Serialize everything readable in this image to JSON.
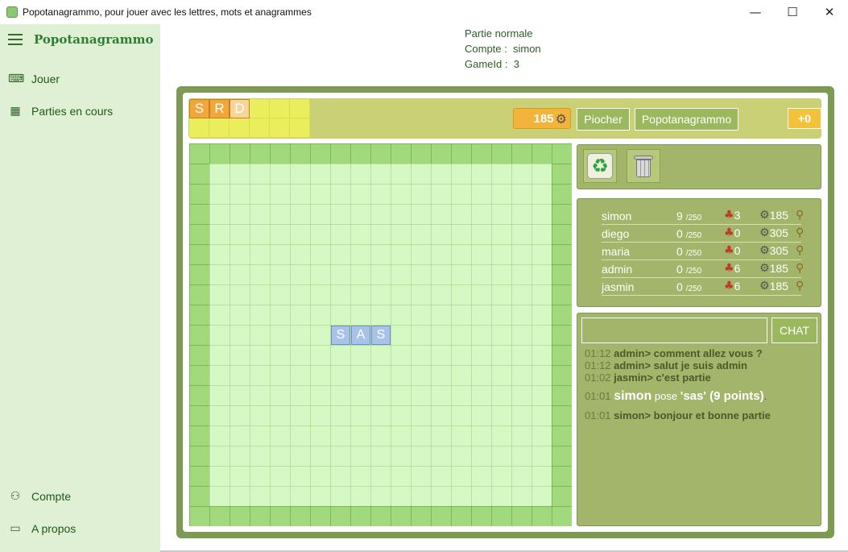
{
  "window": {
    "title": "Popotanagrammo, pour jouer avec les lettres, mots et anagrammes",
    "minimize": "—",
    "maximize": "☐",
    "close": "✕"
  },
  "sidebar": {
    "brand": "Popotanagrammo",
    "items": [
      {
        "label": "Jouer",
        "icon": "gamepad-icon",
        "glyph": "⌨"
      },
      {
        "label": "Parties en cours",
        "icon": "grid-icon",
        "glyph": "▦"
      },
      {
        "label": "Compte",
        "icon": "user-icon",
        "glyph": "⚇"
      },
      {
        "label": "A propos",
        "icon": "comment-icon",
        "glyph": "▭"
      }
    ]
  },
  "info": {
    "mode": "Partie normale",
    "account_label": "Compte :",
    "account_value": "simon",
    "gameid_label": "GameId :",
    "gameid_value": "3"
  },
  "rack": {
    "tiles": [
      "S",
      "R",
      "D"
    ]
  },
  "toolbar": {
    "score": "185",
    "piocher": "Piocher",
    "popotanagrammo": "Popotanagrammo",
    "bonus": "+0"
  },
  "board": {
    "tiles": [
      "S",
      "A",
      "S"
    ]
  },
  "players": [
    {
      "name": "simon",
      "score": "9",
      "max": "/250",
      "tiles": "3",
      "points": "185"
    },
    {
      "name": "diego",
      "score": "0",
      "max": "/250",
      "tiles": "0",
      "points": "305"
    },
    {
      "name": "maria",
      "score": "0",
      "max": "/250",
      "tiles": "0",
      "points": "305"
    },
    {
      "name": "admin",
      "score": "0",
      "max": "/250",
      "tiles": "6",
      "points": "185"
    },
    {
      "name": "jasmin",
      "score": "0",
      "max": "/250",
      "tiles": "6",
      "points": "185"
    }
  ],
  "chat": {
    "placeholder": "",
    "button": "CHAT",
    "messages": [
      {
        "time": "01:12",
        "text": "admin> comment allez vous ?"
      },
      {
        "time": "01:12",
        "text": "admin> salut je suis admin"
      },
      {
        "time": "01:02",
        "text": "jasmin> c'est partie"
      }
    ],
    "move": {
      "time": "01:01",
      "who": "simon",
      "verb": "pose",
      "word": "'sas' (9 points)",
      "end": "."
    },
    "last": {
      "time": "01:01",
      "text": "simon> bonjour et bonne partie"
    }
  },
  "colors": {
    "sidebar_bg": "#dff0d4",
    "panel_olive": "#a2b56a",
    "board_green": "#a2d97c",
    "rack_tile": "#f3a63a",
    "board_tile": "#a9c3e8"
  }
}
